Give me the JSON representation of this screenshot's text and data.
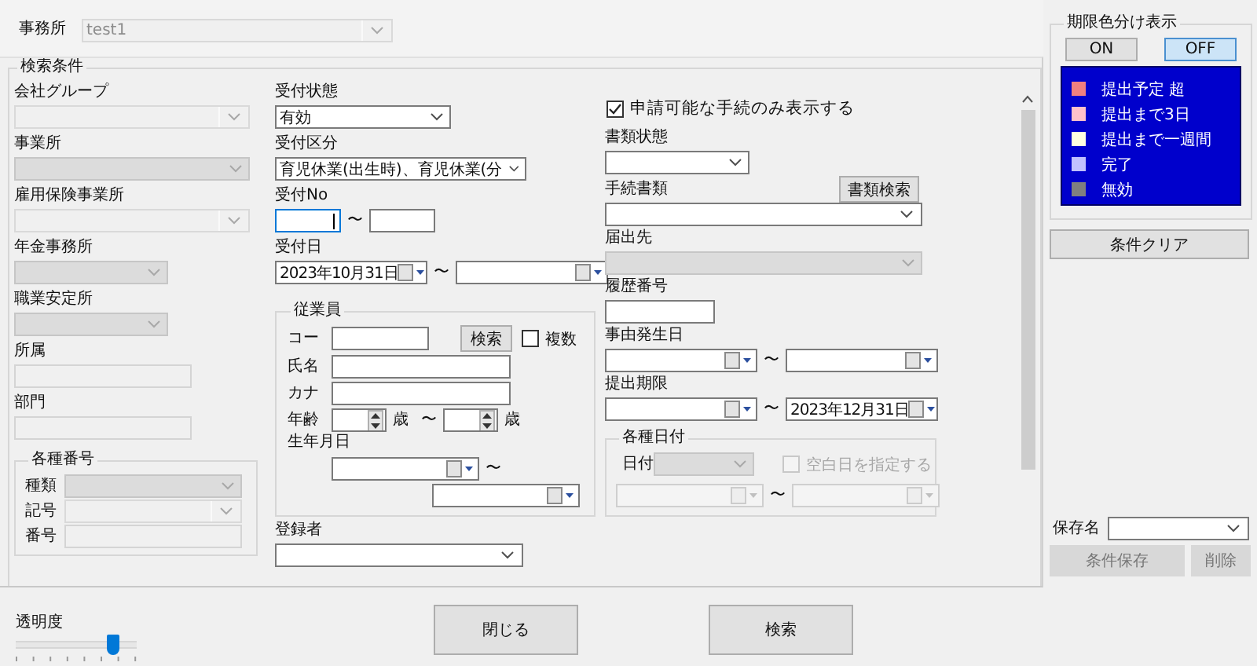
{
  "office": {
    "label": "事務所",
    "field": {
      "kind": "combo",
      "value": "test1",
      "disabled": true
    }
  },
  "conditions_title": "検索条件",
  "column_1": [
    {
      "label": "会社グループ",
      "kind": "combo",
      "disabled": true
    },
    {
      "label": "事業所",
      "kind": "dropdown",
      "disabled": true
    },
    {
      "label": "雇用保険事業所",
      "kind": "combo",
      "disabled": true
    },
    {
      "label": "年金事務所",
      "kind": "dropdown",
      "disabled": true
    },
    {
      "label": "職業安定所",
      "kind": "dropdown",
      "disabled": true
    },
    {
      "label": "所属",
      "kind": "text",
      "disabled": true
    },
    {
      "label": "部門",
      "kind": "text",
      "disabled": true
    }
  ],
  "numbers_group": {
    "title": "各種番号",
    "rows": [
      {
        "label": "種類",
        "kind": "dropdown",
        "disabled": true
      },
      {
        "label": "記号",
        "kind": "combo",
        "disabled": true
      },
      {
        "label": "番号",
        "kind": "text",
        "disabled": true
      }
    ]
  },
  "column_2": [
    {
      "label": "受付状態",
      "kind": "dropdown",
      "value": "有効",
      "disabled": false
    },
    {
      "label": "受付区分",
      "kind": "dropdown",
      "value": "育児休業(出生時)、育児休業(分",
      "disabled": false
    },
    {
      "label": "受付No",
      "kind": "range",
      "from": {
        "kind": "text",
        "focused": true,
        "disabled": false
      },
      "separator": "〜",
      "to": {
        "kind": "text",
        "focused": false,
        "disabled": false
      }
    },
    {
      "label": "受付日",
      "kind": "range",
      "from": {
        "kind": "date",
        "value": "2023年10月31日",
        "disabled": false
      },
      "separator": "〜",
      "to": {
        "kind": "date",
        "disabled": false
      }
    }
  ],
  "employee": {
    "title": "従業員",
    "code": {
      "label": "コー",
      "field": {
        "kind": "text",
        "disabled": false
      },
      "search_button": "検索",
      "multiple": {
        "label": "複数",
        "checked": false,
        "disabled": false
      }
    },
    "name": {
      "label": "氏名",
      "field": {
        "kind": "text",
        "disabled": false
      }
    },
    "kana": {
      "label": "カナ",
      "field": {
        "kind": "text",
        "disabled": false
      }
    },
    "age": {
      "label": "年齢",
      "from": {
        "kind": "spin",
        "disabled": false
      },
      "unit_from": "歳",
      "separator": "〜",
      "to": {
        "kind": "spin",
        "disabled": false
      },
      "unit_to": "歳"
    },
    "birth_date": {
      "label": "生年月日",
      "from": {
        "kind": "date",
        "disabled": false
      },
      "separator": "〜",
      "to": {
        "kind": "date",
        "disabled": false
      }
    }
  },
  "registrant": {
    "label": "登録者",
    "kind": "combo",
    "disabled": false
  },
  "only_applicable": {
    "label": "申請可能な手続のみ表示する",
    "checked": true,
    "disabled": false
  },
  "column_3": [
    {
      "label": "書類状態",
      "kind": "dropdown",
      "disabled": false
    },
    {
      "label": "手続書類",
      "kind": "combo",
      "disabled": false,
      "button": "書類検索"
    },
    {
      "label": "届出先",
      "kind": "dropdown",
      "disabled": true
    },
    {
      "label": "履歴番号",
      "kind": "text",
      "disabled": false
    },
    {
      "label": "事由発生日",
      "kind": "range",
      "from": {
        "kind": "date",
        "disabled": false
      },
      "separator": "〜",
      "to": {
        "kind": "date",
        "disabled": false
      }
    },
    {
      "label": "提出期限",
      "kind": "range",
      "from": {
        "kind": "date",
        "disabled": false
      },
      "separator": "〜",
      "to": {
        "kind": "date",
        "value": "2023年12月31日",
        "disabled": false
      }
    }
  ],
  "dates_group": {
    "title": "各種日付",
    "date_label": "日付",
    "date_type": {
      "kind": "dropdown",
      "disabled": true
    },
    "blank_date": {
      "label": "空白日を指定する",
      "checked": false,
      "disabled": true
    },
    "from": {
      "kind": "date",
      "disabled": true
    },
    "separator": "〜",
    "to": {
      "kind": "date",
      "disabled": true
    }
  },
  "color_legend": {
    "title": "期限色分け表示",
    "toggles": [
      {
        "label": "ON",
        "selected": false
      },
      {
        "label": "OFF",
        "selected": true
      }
    ],
    "items": [
      {
        "label": "提出予定 超",
        "color": "#f08080"
      },
      {
        "label": "提出まで3日",
        "color": "#ffc0cb"
      },
      {
        "label": "提出まで一週間",
        "color": "#ffffe0"
      },
      {
        "label": "完了",
        "color": "#c0c0ff"
      },
      {
        "label": "無効",
        "color": "#808080"
      }
    ]
  },
  "clear_button": "条件クリア",
  "saved_conditions": {
    "label": "保存名",
    "name_field": {
      "kind": "combo",
      "disabled": false
    },
    "save_button": {
      "label": "条件保存",
      "disabled": true
    },
    "delete_button": {
      "label": "削除",
      "disabled": true
    }
  },
  "opacity": {
    "label": "透明度",
    "level": 0.8
  },
  "actions": [
    "閉じる",
    "検索"
  ]
}
